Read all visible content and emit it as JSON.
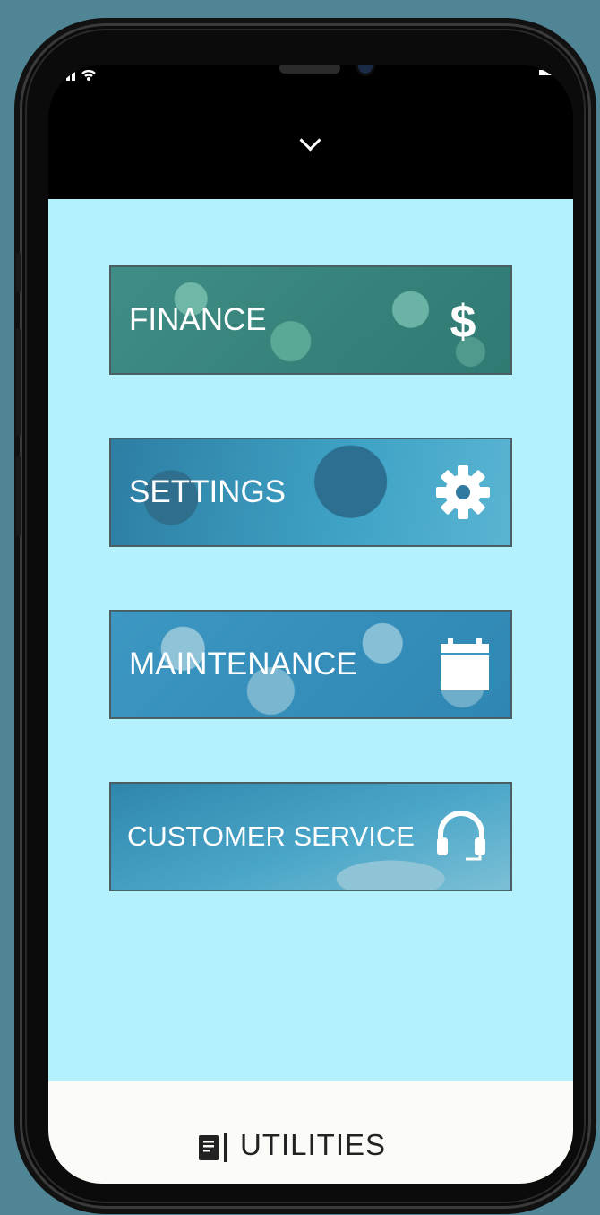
{
  "colors": {
    "page_background": "#4f8595",
    "content_background": "#b5f1fd",
    "footer_background": "#fbfbf8",
    "tile_finance": "#3f8d86",
    "tile_settings": "#3a8fb0",
    "tile_maintenance": "#3c97c2",
    "tile_customer_service": "#3e9bbd"
  },
  "header": {
    "toggle_icon": "chevron-down-icon"
  },
  "menu": {
    "items": [
      {
        "label": "FINANCE",
        "icon": "dollar-icon"
      },
      {
        "label": "SETTINGS",
        "icon": "gear-icon"
      },
      {
        "label": "MAINTENANCE",
        "icon": "calendar-icon"
      },
      {
        "label": "CUSTOMER SERVICE",
        "icon": "headset-icon"
      }
    ]
  },
  "footer": {
    "icon": "document-icon",
    "label": "UTILITIES"
  }
}
